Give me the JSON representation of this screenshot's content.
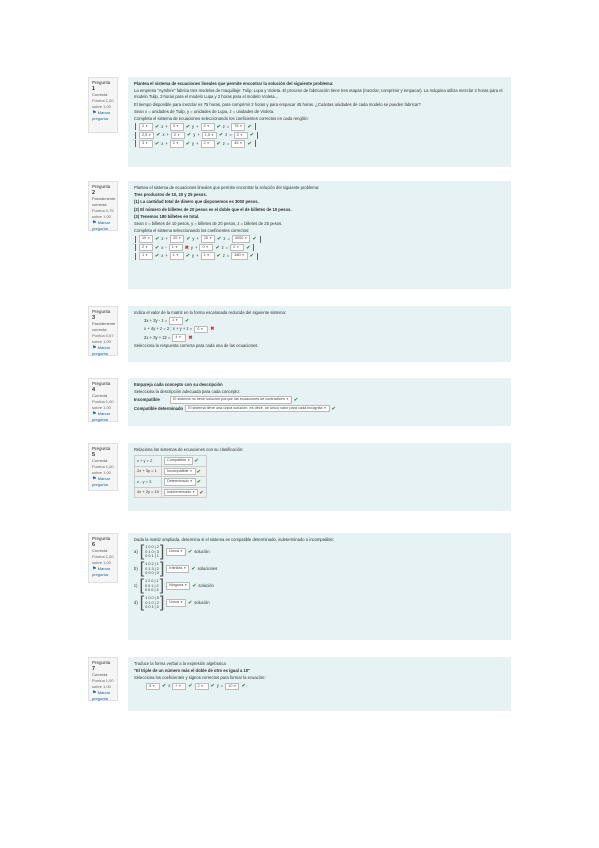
{
  "accent_color": "#0a63a8",
  "correct_color": "#3a8e3a",
  "incorrect_color": "#c0392b",
  "q1": {
    "qnum_label": "Pregunta",
    "qnum": "1",
    "state": "Correcta",
    "mark": "Puntúa 1,00 sobre 1,00",
    "flag": "Marcar pregunta",
    "heading": "Plantea el sistema de ecuaciones lineales que permite encontrar la solución del siguiente problema:",
    "text1": "La empresa \"Ayrshire\" fabrica tres modelos de maquillaje: Tulip, Lupa y Violeta. El proceso de fabricación tiene tres etapas (mezclar, comprimir y empacar). La máquina utiliza mezclar 2 horas para el modelo Tulip, 3 horas para el modelo Lupa y 2 horas para el modelo Violeta...",
    "text2": "El tiempo disponible para mezclar es 75 horas, para comprimir 2 horas y para empacar 45 horas. ¿Cuántas unidades de cada modelo se pueden fabricar?",
    "text3": "Sean x = unidades de Tulip, y = unidades de Lupa, z = unidades de Violeta.",
    "instruction": "Completa el sistema de ecuaciones seleccionando los coeficientes correctos en cada renglón:",
    "rows": [
      [
        "2",
        "x",
        "+",
        "3",
        "y",
        "+",
        "2",
        "z",
        "=",
        "75"
      ],
      [
        "2,5",
        "x",
        "+",
        "2",
        "y",
        "+",
        "1,5",
        "z",
        "=",
        "2"
      ],
      [
        "3",
        "x",
        "+",
        "2",
        "y",
        "+",
        "2",
        "z",
        "=",
        "45"
      ]
    ]
  },
  "q2": {
    "qnum_label": "Pregunta",
    "qnum": "2",
    "state": "Parcialmente correcta",
    "mark": "Puntúa 0,75 sobre 1,00",
    "flag": "Marcar pregunta",
    "heading": "Plantea el sistema de ecuaciones lineales que permite encontrar la solución del siguiente problema:",
    "line1": "Tres productos de 10, 20 y 25 pesos.",
    "line2": "(1) La cantidad total de dinero que disponemos es 3000 pesos.",
    "line3": "(2) El número de billetes de 20 pesos es el doble que el de billetes de 10 pesos.",
    "line4": "(3) Tenemos 180 billetes en total.",
    "line5": "Sean x = billetes de 10 pesos, y = billetes de 20 pesos, z = billetes de 25 pesos.",
    "line6": "Completa el sistema seleccionando los coeficientes correctos:",
    "rows": [
      [
        "10",
        "x",
        "+",
        "20",
        "y",
        "+",
        "25",
        "z",
        "=",
        "3000"
      ],
      [
        "2",
        "x",
        "-",
        "1",
        "y",
        "+",
        "0",
        "z",
        "=",
        "0"
      ],
      [
        "1",
        "x",
        "+",
        "1",
        "y",
        "+",
        "1",
        "z",
        "=",
        "180"
      ]
    ],
    "marks": [
      "ok",
      "bad",
      "ok"
    ]
  },
  "q3": {
    "qnum_label": "Pregunta",
    "qnum": "3",
    "state": "Parcialmente correcta",
    "mark": "Puntúa 0,67 sobre 1,00",
    "flag": "Marcar pregunta",
    "heading": "Indica el valor de la matriz en la forma escalonada reducida del siguiente sistema:",
    "rows": [
      {
        "label": "3x + 2y - z =",
        "value": "1",
        "mark": "ok"
      },
      {
        "label": "x + 4y + z = 2 ; x + y + z =",
        "value": "0",
        "mark": "bad"
      },
      {
        "label": "2x + 3y + 2z =",
        "value": "4",
        "mark": "bad"
      }
    ],
    "footer": "Selecciona la respuesta correcta para cada una de las ecuaciones."
  },
  "q4": {
    "qnum_label": "Pregunta",
    "qnum": "4",
    "state": "Correcta",
    "mark": "Puntúa 1,00 sobre 1,00",
    "flag": "Marcar pregunta",
    "heading": "Empareja cada concepto con su descripción",
    "sub": "Selecciona la descripción adecuada para cada concepto:",
    "rows": [
      {
        "label": "Incompatible",
        "value": "El sistema no tiene solución porque las ecuaciones se contradicen",
        "mark": "ok"
      },
      {
        "label": "Compatible determinado",
        "value": "El sistema tiene una única solución, es decir, un único valor para cada incógnita",
        "mark": "ok"
      }
    ]
  },
  "q5": {
    "qnum_label": "Pregunta",
    "qnum": "5",
    "state": "Correcta",
    "mark": "Puntúa 1,00 sobre 1,00",
    "flag": "Marcar pregunta",
    "heading": "Relaciona los sistemas de ecuaciones con su clasificación:",
    "rows": [
      {
        "label": "x + y = 2",
        "value": "Compatible",
        "mark": "ok"
      },
      {
        "label": "2x + 3y = 1",
        "value": "Incompatible",
        "mark": "ok"
      },
      {
        "label": "x - y = 3",
        "value": "Determinado",
        "mark": "ok"
      },
      {
        "label": "4x + 2y = 10",
        "value": "Indeterminado",
        "mark": "ok"
      }
    ]
  },
  "q6": {
    "qnum_label": "Pregunta",
    "qnum": "6",
    "state": "Correcta",
    "mark": "Puntúa 1,00 sobre 1,00",
    "flag": "Marcar pregunta",
    "heading": "Dada la matriz ampliada, determina si el sistema es compatible determinado, indeterminado o incompatible:",
    "items": [
      {
        "letter": "a)",
        "rows": [
          "1 0 0 | 2",
          "0 1 0 | 3",
          "0 0 1 | 1"
        ],
        "value": "Única",
        "mark": "ok",
        "after": "solución"
      },
      {
        "letter": "b)",
        "rows": [
          "1 0 2 | 1",
          "0 1 3 | 2",
          "0 0 0 | 0"
        ],
        "value": "Infinitas",
        "mark": "ok",
        "after": "soluciones"
      },
      {
        "letter": "c)",
        "rows": [
          "1 2 0 | 1",
          "0 0 1 | 2",
          "0 0 0 | 4"
        ],
        "value": "Ninguna",
        "mark": "ok",
        "after": "solución"
      },
      {
        "letter": "d)",
        "rows": [
          "1 0 0 | 5",
          "0 1 0 | 2",
          "0 0 1 | 0"
        ],
        "value": "Única",
        "mark": "ok",
        "after": "solución"
      }
    ]
  },
  "q7": {
    "qnum_label": "Pregunta",
    "qnum": "7",
    "state": "Correcta",
    "mark": "Puntúa 1,00 sobre 1,00",
    "flag": "Marcar pregunta",
    "heading": "Traduce la forma verbal a la expresión algebraica",
    "line1": "\"El triple de un número más el doble de otro es igual a 10\"",
    "line2": "Selecciona los coeficientes y signos correctos para formar la ecuación:",
    "eq": [
      "3",
      "x",
      "+",
      "2",
      "y",
      "=",
      "10"
    ]
  }
}
